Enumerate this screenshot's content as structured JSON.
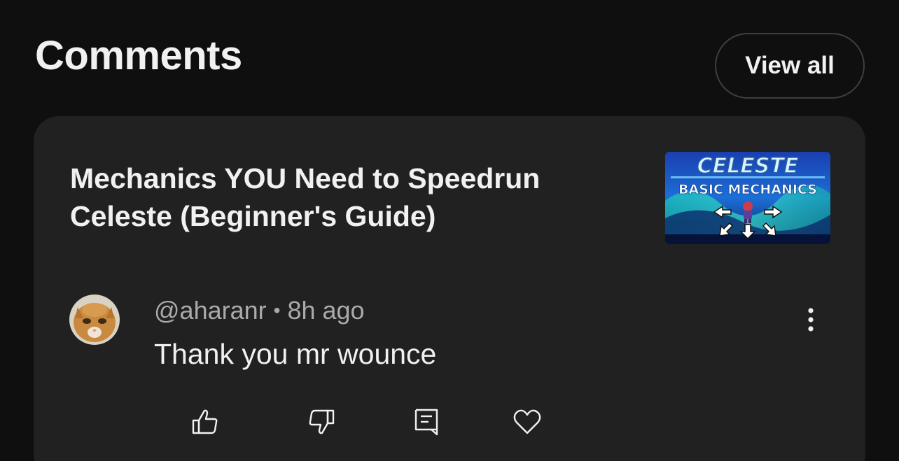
{
  "section": {
    "title": "Comments",
    "view_all_label": "View all"
  },
  "video": {
    "title": "Mechanics YOU Need to Speedrun Celeste (Beginner's Guide)",
    "thumbnail": {
      "game_title": "CELESTE",
      "subtitle": "BASIC MECHANICS"
    }
  },
  "comment": {
    "author": "@aharanr",
    "separator": "•",
    "time": "8h ago",
    "text": "Thank you mr wounce"
  },
  "icons": {
    "more": "more-vertical-icon",
    "like": "thumbs-up-icon",
    "dislike": "thumbs-down-icon",
    "reply": "reply-comment-icon",
    "heart": "heart-icon"
  },
  "colors": {
    "background": "#0f0f0f",
    "card": "#212121",
    "text_primary": "#f1f1f1",
    "text_secondary": "#aaaaaa",
    "button_border": "#3f3f3f"
  }
}
